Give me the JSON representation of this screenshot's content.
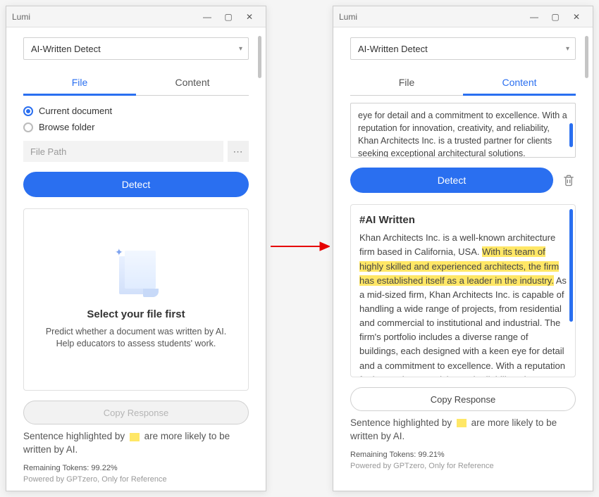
{
  "app": {
    "title": "Lumi"
  },
  "dropdown": {
    "value": "AI-Written Detect"
  },
  "tabs": {
    "file": "File",
    "content": "Content"
  },
  "left": {
    "radio_current": "Current document",
    "radio_browse": "Browse folder",
    "file_path_placeholder": "File Path",
    "detect": "Detect",
    "placeholder_title": "Select your file first",
    "placeholder_sub": "Predict whether a document was written by AI. Help educators to assess students' work.",
    "copy_response": "Copy Response",
    "tokens": "Remaining Tokens: 99.22%"
  },
  "right": {
    "textarea_excerpt": "eye for detail and a commitment to excellence. With a reputation for innovation, creativity, and reliability, Khan Architects Inc. is a trusted partner for clients seeking exceptional architectural solutions.",
    "detect": "Detect",
    "result_title": "#AI Written",
    "body_before": "Khan Architects Inc. is a well-known architecture firm based in California, USA. ",
    "body_highlight": "With its team of highly skilled and experienced architects, the firm has established itself as a leader in the industry.",
    "body_after": " As a mid-sized firm, Khan Architects Inc. is capable of handling a wide range of projects, from residential and commercial to institutional and industrial. The firm's portfolio includes a diverse range of buildings, each designed with a keen eye for detail and a commitment to excellence. With a reputation for innovation, creativity, and reliability, Khan Architects",
    "copy_response": "Copy Response",
    "tokens": "Remaining Tokens: 99.21%"
  },
  "legend": {
    "before": "Sentence highlighted by ",
    "after": " are more likely to be written by AI."
  },
  "powered": "Powered by GPTzero, Only for Reference"
}
